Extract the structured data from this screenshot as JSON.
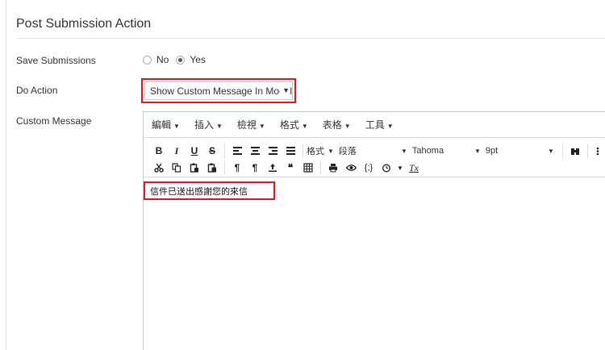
{
  "section": {
    "title": "Post Submission Action"
  },
  "save_submissions": {
    "label": "Save Submissions",
    "options": [
      {
        "label": "No",
        "checked": false
      },
      {
        "label": "Yes",
        "checked": true
      }
    ]
  },
  "do_action": {
    "label": "Do Action",
    "selected": "Show Custom Message In Modal",
    "arrow": "▼"
  },
  "custom_message": {
    "label": "Custom Message",
    "menu": [
      "編輯",
      "插入",
      "檢視",
      "格式",
      "表格",
      "工具"
    ],
    "toolbar": {
      "bold": "B",
      "italic": "I",
      "underline": "U",
      "strike": "S",
      "format_label": "格式",
      "block_format": "段落",
      "font_family": "Tahoma",
      "font_size": "9pt",
      "pilcrow": "¶",
      "pilcrow_rev": "¶",
      "blockquote": "❝",
      "code": "{;}",
      "clear_format": "Tx"
    },
    "content": "信件已送出感謝您的來信"
  },
  "colors": {
    "highlight": "#e8141b",
    "border": "#c9c9c9"
  }
}
